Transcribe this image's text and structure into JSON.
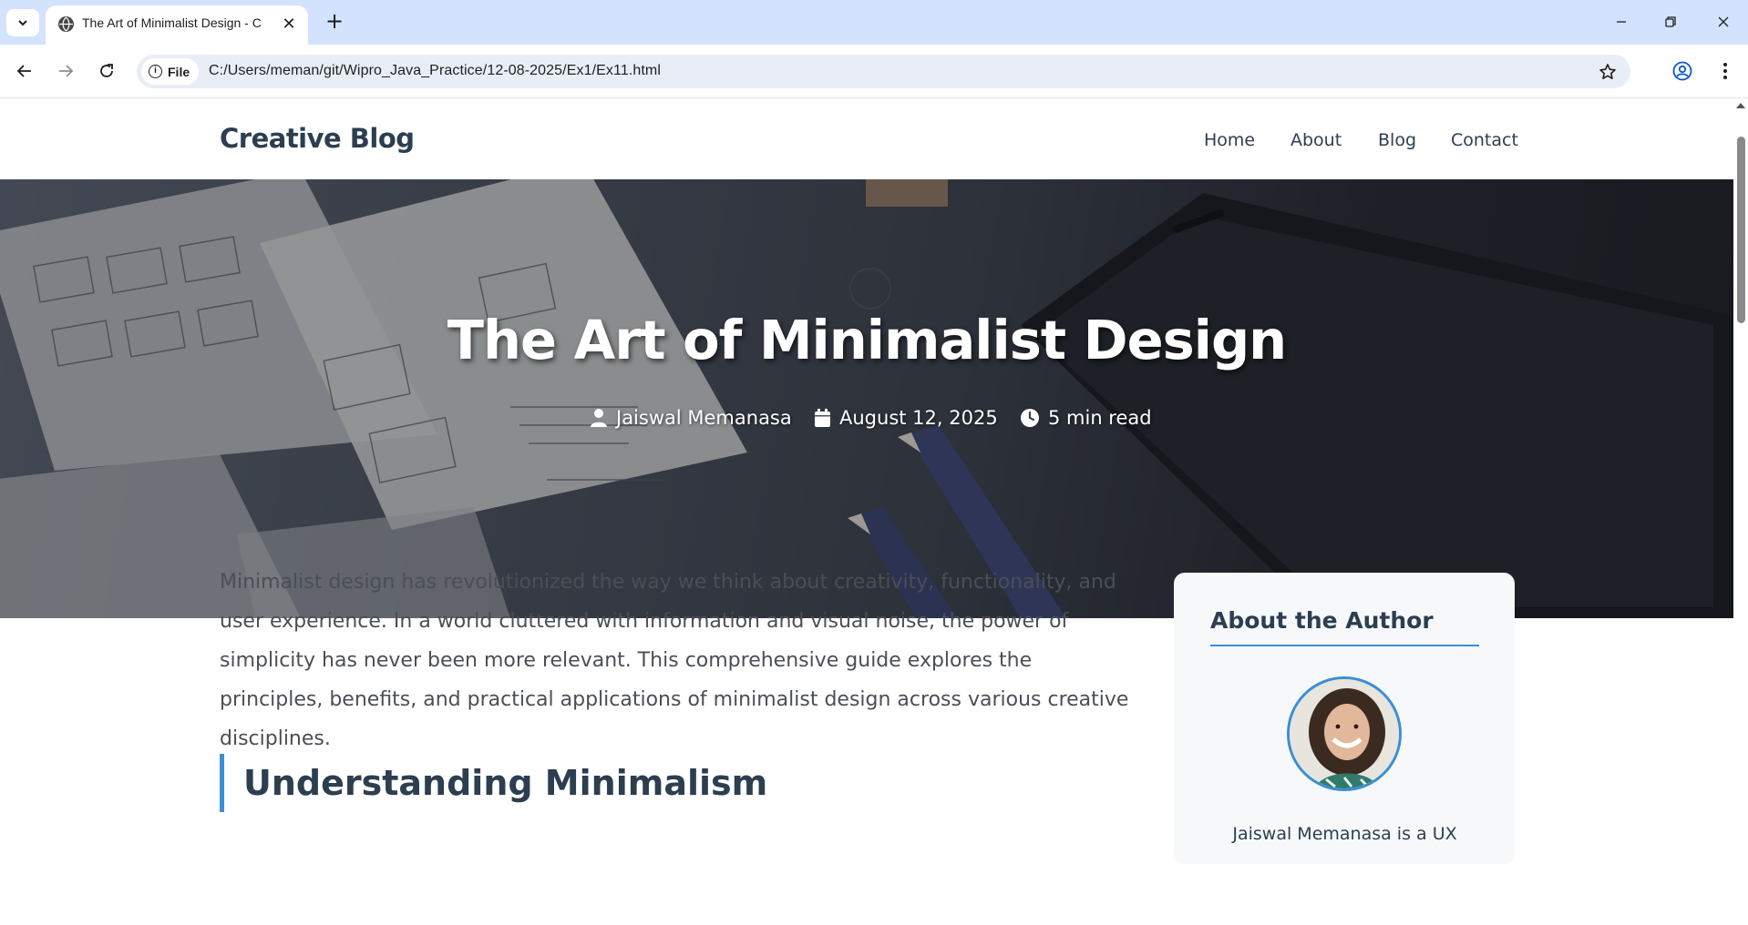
{
  "browser": {
    "tab_title": "The Art of Minimalist Design - C",
    "address_chip": "File",
    "url": "C:/Users/meman/git/Wipro_Java_Practice/12-08-2025/Ex1/Ex11.html"
  },
  "site": {
    "logo": "Creative Blog",
    "nav": [
      "Home",
      "About",
      "Blog",
      "Contact"
    ]
  },
  "hero": {
    "title": "The Art of Minimalist Design",
    "author": "Jaiswal Memanasa",
    "date": "August 12, 2025",
    "read_time": "5 min read"
  },
  "article": {
    "intro": "Minimalist design has revolutionized the way we think about creativity, functionality, and user experience. In a world cluttered with information and visual noise, the power of simplicity has never been more relevant. This comprehensive guide explores the principles, benefits, and practical applications of minimalist design across various creative disciplines.",
    "section_title": "Understanding Minimalism"
  },
  "sidebar": {
    "title": "About the Author",
    "author_line": "Jaiswal Memanasa is a UX"
  },
  "colors": {
    "accent": "#3a8fd6",
    "heading": "#2c3e50",
    "tabbar": "#d3e3fd"
  }
}
